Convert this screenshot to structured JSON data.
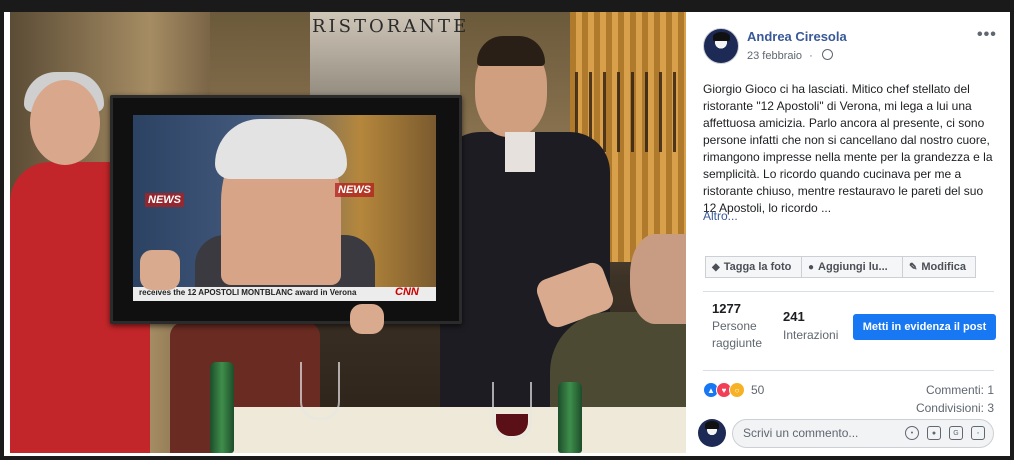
{
  "photo": {
    "sign_text": "RISTORANTE",
    "tv_logo_left": "NEWS",
    "tv_logo_right": "NEWS",
    "tv_caption": "receives the 12 APOSTOLI MONTBLANC award in Verona",
    "tv_brand": "CNN"
  },
  "post": {
    "author": "Andrea Ciresola",
    "date": "23 febbraio",
    "more_icon": "more-dots-icon",
    "text": "Giorgio Gioco ci ha lasciati. Mitico chef stellato del ristorante \"12 Apostoli\" di Verona, mi lega a lui una affettuosa amicizia. Parlo ancora al presente, ci sono persone infatti che non si cancellano dal nostro cuore, rimangono impresse nella mente per la grandezza e la semplicità. Lo ricordo quando cucinava per me a ristorante chiuso, mentre restauravo le pareti del suo 12 Apostoli, lo ricordo ...",
    "see_more": "Altro...",
    "actions": {
      "tag": "Tagga la foto",
      "location": "Aggiungi lu...",
      "edit": "Modifica"
    },
    "stats": {
      "reach_value": "1277",
      "reach_label_1": "Persone",
      "reach_label_2": "raggiunte",
      "interactions_value": "241",
      "interactions_label": "Interazioni"
    },
    "promote": "Metti in evidenza il post",
    "reactions_count": "50",
    "comments": "Commenti: 1",
    "shares": "Condivisioni: 3",
    "comment_placeholder": "Scrivi un commento...",
    "colors": {
      "link": "#385898",
      "primary": "#1877f2"
    }
  }
}
